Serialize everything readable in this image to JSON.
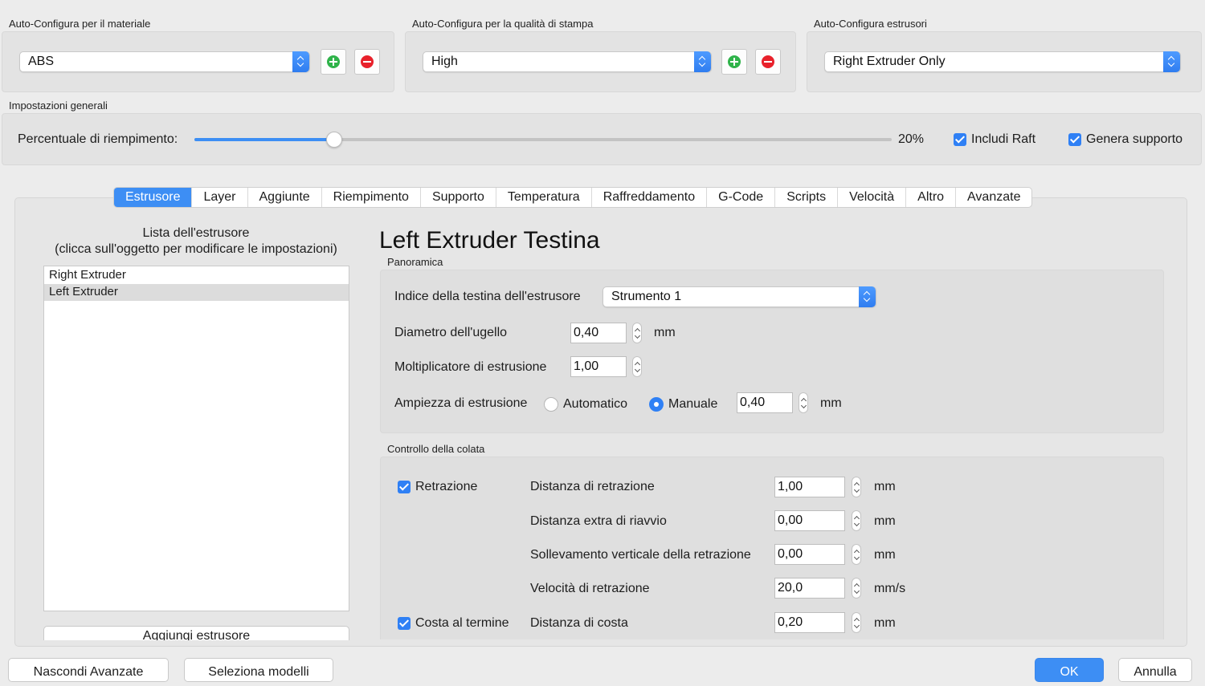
{
  "material": {
    "label": "Auto-Configura per il materiale",
    "value": "ABS"
  },
  "quality": {
    "label": "Auto-Configura per la qualità di stampa",
    "value": "High"
  },
  "extruders": {
    "label": "Auto-Configura estrusori",
    "value": "Right Extruder Only"
  },
  "general": {
    "label": "Impostazioni generali",
    "infill_label": "Percentuale di riempimento:",
    "infill_value": "20%",
    "infill_fraction": 0.2,
    "raft_label": "Includi Raft",
    "support_label": "Genera supporto"
  },
  "tabs": [
    "Estrusore",
    "Layer",
    "Aggiunte",
    "Riempimento",
    "Supporto",
    "Temperatura",
    "Raffreddamento",
    "G-Code",
    "Scripts",
    "Velocità",
    "Altro",
    "Avanzate"
  ],
  "extruder_list": {
    "title_line1": "Lista dell'estrusore",
    "title_line2": "(clicca sull'oggetto per modificare le impostazioni)",
    "items": [
      "Right Extruder",
      "Left Extruder"
    ],
    "add_button": "Aggiungi estrusore"
  },
  "detail": {
    "title": "Left Extruder Testina",
    "overview_label": "Panoramica",
    "head_index_label": "Indice della testina dell'estrusore",
    "head_index_value": "Strumento 1",
    "nozzle_label": "Diametro dell'ugello",
    "nozzle_value": "0,40",
    "nozzle_unit": "mm",
    "multiplier_label": "Moltiplicatore di estrusione",
    "multiplier_value": "1,00",
    "width_label": "Ampiezza di estrusione",
    "width_auto": "Automatico",
    "width_manual": "Manuale",
    "width_value": "0,40",
    "width_unit": "mm",
    "ooze_label": "Controllo della colata",
    "retraction_label": "Retrazione",
    "coast_label": "Costa al termine",
    "rows": [
      {
        "label": "Distanza di retrazione",
        "value": "1,00",
        "unit": "mm"
      },
      {
        "label": "Distanza extra di riavvio",
        "value": "0,00",
        "unit": "mm"
      },
      {
        "label": "Sollevamento verticale della retrazione",
        "value": "0,00",
        "unit": "mm"
      },
      {
        "label": "Velocità di retrazione",
        "value": "20,0",
        "unit": "mm/s"
      },
      {
        "label": "Distanza di costa",
        "value": "0,20",
        "unit": "mm"
      }
    ]
  },
  "bottom": {
    "hide_advanced": "Nascondi Avanzate",
    "select_models": "Seleziona modelli",
    "ok": "OK",
    "cancel": "Annulla"
  }
}
